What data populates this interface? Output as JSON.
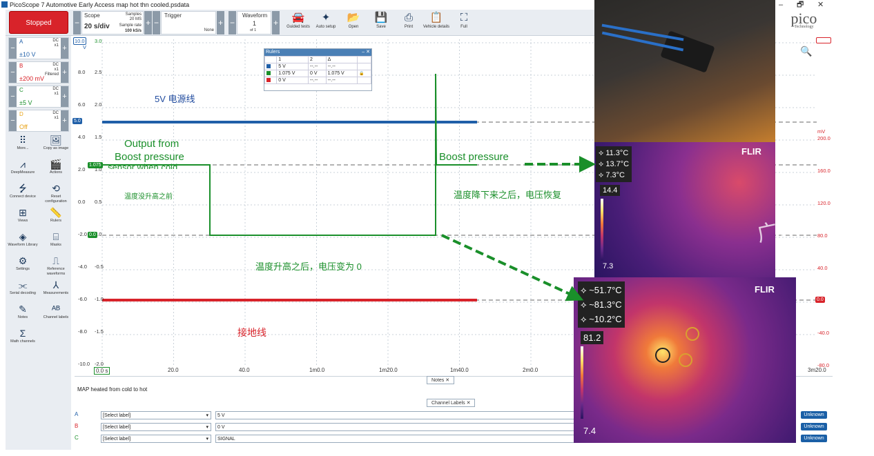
{
  "window": {
    "title": "PicoScope 7 Automotive Early Access map hot thn cooled.psdata",
    "minimize": "–",
    "restore": "🗗",
    "close": "✕"
  },
  "toolbar": {
    "stop_label": "Stopped",
    "scope_label": "Scope",
    "timebase": "20 s/div",
    "samples_label": "Samples",
    "samples_value": "20 MS",
    "sample_rate_label": "Sample rate",
    "sample_rate_value": "100 kS/s",
    "trigger_label": "Trigger",
    "trigger_mode": "None",
    "waveform_label": "Waveform",
    "waveform_index": "1",
    "waveform_of": "of 1",
    "buttons": [
      {
        "label": "Guided tests",
        "icon": "car-icon",
        "glyph": "🚘"
      },
      {
        "label": "Auto setup",
        "icon": "wand-icon",
        "glyph": "✦"
      },
      {
        "label": "Open",
        "icon": "folder-icon",
        "glyph": "📂"
      },
      {
        "label": "Save",
        "icon": "save-icon",
        "glyph": "💾"
      },
      {
        "label": "Print",
        "icon": "print-icon",
        "glyph": "⎙"
      },
      {
        "label": "Vehicle details",
        "icon": "clipboard-icon",
        "glyph": "📋"
      },
      {
        "label": "Full",
        "icon": "fullscreen-icon",
        "glyph": "⛶"
      }
    ]
  },
  "channels": [
    {
      "name": "A",
      "coupling": "DC",
      "probe": "x1",
      "filter": "",
      "range": "±10 V",
      "color": "#1f5fa8"
    },
    {
      "name": "B",
      "coupling": "DC",
      "probe": "x1",
      "filter": "Filtered",
      "range": "±200 mV",
      "color": "#d8232a"
    },
    {
      "name": "C",
      "coupling": "DC",
      "probe": "x1",
      "filter": "",
      "range": "±5 V",
      "color": "#1a8f2a"
    },
    {
      "name": "D",
      "coupling": "DC",
      "probe": "x1",
      "filter": "",
      "range": "Off",
      "color": "#e8a317"
    }
  ],
  "tools": [
    {
      "label": "More...",
      "icon": "more-icon",
      "glyph": "⠿"
    },
    {
      "label": "Copy as image",
      "icon": "image-icon",
      "glyph": "🖼"
    },
    {
      "label": "DeepMeasure",
      "icon": "deepmeasure-icon",
      "glyph": "⩘"
    },
    {
      "label": "Actions",
      "icon": "clapper-icon",
      "glyph": "🎬"
    },
    {
      "label": "Connect device",
      "icon": "usb-icon",
      "glyph": "⭍"
    },
    {
      "label": "Reset configuration",
      "icon": "reset-icon",
      "glyph": "⟲"
    },
    {
      "label": "Views",
      "icon": "views-icon",
      "glyph": "⊞"
    },
    {
      "label": "Rulers",
      "icon": "ruler-icon",
      "glyph": "📏"
    },
    {
      "label": "Waveform Library",
      "icon": "library-icon",
      "glyph": "◈"
    },
    {
      "label": "Masks",
      "icon": "mask-icon",
      "glyph": "⌸"
    },
    {
      "label": "Settings",
      "icon": "gear-icon",
      "glyph": "⚙"
    },
    {
      "label": "Reference waveforms",
      "icon": "reference-icon",
      "glyph": "⎍"
    },
    {
      "label": "Serial decoding",
      "icon": "serial-icon",
      "glyph": "⫘"
    },
    {
      "label": "Measurements",
      "icon": "measure-icon",
      "glyph": "⅄"
    },
    {
      "label": "Notes",
      "icon": "notes-icon",
      "glyph": "✎"
    },
    {
      "label": "Channel labels",
      "icon": "labels-icon",
      "glyph": "ᴬᴮ"
    },
    {
      "label": "Math channels",
      "icon": "sigma-icon",
      "glyph": "Σ"
    }
  ],
  "plot": {
    "y_axis_a_unit": "V",
    "y_axis_a_scale": "10.0",
    "y_axis_a": [
      "8.0",
      "6.0",
      "4.0",
      "2.0",
      "0.0",
      "-2.0",
      "-4.0",
      "-6.0",
      "-8.0",
      "-10.0"
    ],
    "y_axis_c": [
      "3.0",
      "2.5",
      "2.0",
      "1.5",
      "1.0",
      "0.5",
      "0.0",
      "-0.5",
      "-1.0",
      "-1.5",
      "-2.0"
    ],
    "y_axis_b_unit": "mV",
    "y_axis_b": [
      "200.0",
      "160.0",
      "120.0",
      "80.0",
      "40.0",
      "0.0",
      "-40.0",
      "-80.0"
    ],
    "x_axis": [
      "0.0 s",
      "20.0",
      "40.0",
      "1m0.0",
      "1m20.0",
      "1m40.0",
      "2m0.0",
      "3m20.0"
    ],
    "markers": {
      "a": "5.0",
      "c": "1.075",
      "c_low": "0.0",
      "b": "0.0"
    }
  },
  "rulers": {
    "title": "Rulers",
    "headers": [
      "",
      "1",
      "2",
      "Δ",
      ""
    ],
    "rows": [
      {
        "color": "#1f5fa8",
        "v1": "5 V",
        "v2": "--.--",
        "delta": "--.--"
      },
      {
        "color": "#1a8f2a",
        "v1": "1.075 V",
        "v2": "0 V",
        "delta": "1.075 V"
      },
      {
        "color": "#d8232a",
        "v1": "0 V",
        "v2": "--.--",
        "delta": "--.--"
      }
    ]
  },
  "annotations": {
    "power_line": "5V 电源线",
    "output_from": "Output from",
    "boost_pressure_left": "Boost pressure",
    "overlap_text": "sensor when cold",
    "before_heat": "温度没升高之前",
    "boost_pressure_right": "Boost pressure",
    "after_cool": "温度降下来之后，电压恢复",
    "after_heat": "温度升高之后，电压变为 0",
    "ground_line": "接地线"
  },
  "notes": {
    "tab": "Notes",
    "text": "MAP heated from cold to hot"
  },
  "channel_labels": {
    "tab": "Channel Labels",
    "rows": [
      {
        "id": "A",
        "select": "[Select label]",
        "value": "5 V",
        "status": "Unknown"
      },
      {
        "id": "B",
        "select": "[Select label]",
        "value": "0 V",
        "status": "Unknown"
      },
      {
        "id": "C",
        "select": "[Select label]",
        "value": "SIGNAL",
        "status": "Unknown"
      }
    ]
  },
  "brand": {
    "logo": "pico",
    "sub": "Technology"
  },
  "thermal1": {
    "brand": "FLIR",
    "spots": [
      "11.3°C",
      "13.7°C",
      "7.3°C"
    ],
    "max": "14.4",
    "min": "7.3"
  },
  "thermal2": {
    "brand": "FLIR",
    "spots": [
      "~51.7°C",
      "~81.3°C",
      "~10.2°C"
    ],
    "max": "81.2",
    "min": "7.4"
  },
  "watermark": "广州虹科"
}
